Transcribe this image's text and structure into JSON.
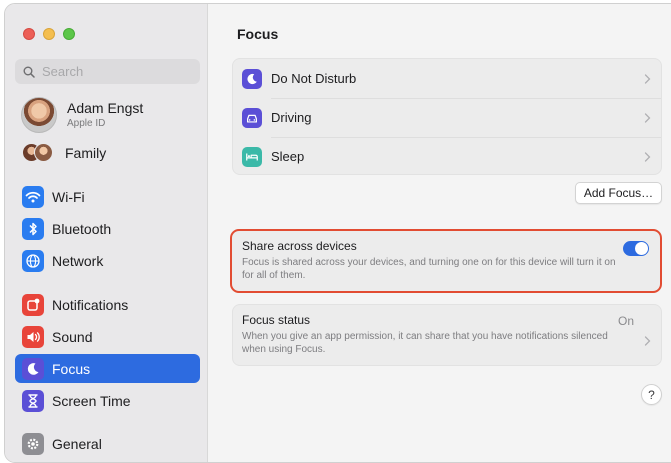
{
  "window": {
    "title": "Focus"
  },
  "sidebar": {
    "search_placeholder": "Search",
    "profile": {
      "name": "Adam Engst",
      "subtitle": "Apple ID"
    },
    "family_label": "Family",
    "items": [
      {
        "label": "Wi-Fi",
        "icon": "wifi-icon",
        "color": "#2a7cf0"
      },
      {
        "label": "Bluetooth",
        "icon": "bluetooth-icon",
        "color": "#2a7cf0"
      },
      {
        "label": "Network",
        "icon": "globe-icon",
        "color": "#2a7cf0"
      },
      {
        "label": "Notifications",
        "icon": "notifications-icon",
        "color": "#e8443a"
      },
      {
        "label": "Sound",
        "icon": "speaker-icon",
        "color": "#e8443a"
      },
      {
        "label": "Focus",
        "icon": "moon-icon",
        "color": "#5b4fd6",
        "selected": true
      },
      {
        "label": "Screen Time",
        "icon": "hourglass-icon",
        "color": "#5b4fd6"
      },
      {
        "label": "General",
        "icon": "gear-icon",
        "color": "#8e8e93"
      }
    ]
  },
  "main": {
    "focus_modes": [
      {
        "label": "Do Not Disturb",
        "icon": "moon-icon",
        "color": "#5b4fd6"
      },
      {
        "label": "Driving",
        "icon": "car-icon",
        "color": "#5b4fd6"
      },
      {
        "label": "Sleep",
        "icon": "bed-icon",
        "color": "#3bb9a8"
      }
    ],
    "add_focus_label": "Add Focus…",
    "share": {
      "title": "Share across devices",
      "description": "Focus is shared across your devices, and turning one on for this device will turn it on for all of them.",
      "enabled": true
    },
    "status": {
      "title": "Focus status",
      "value": "On",
      "description": "When you give an app permission, it can share that you have notifications silenced when using Focus."
    },
    "help_label": "?"
  },
  "colors": {
    "accent": "#2d6be0",
    "highlight_border": "#e24c32"
  }
}
